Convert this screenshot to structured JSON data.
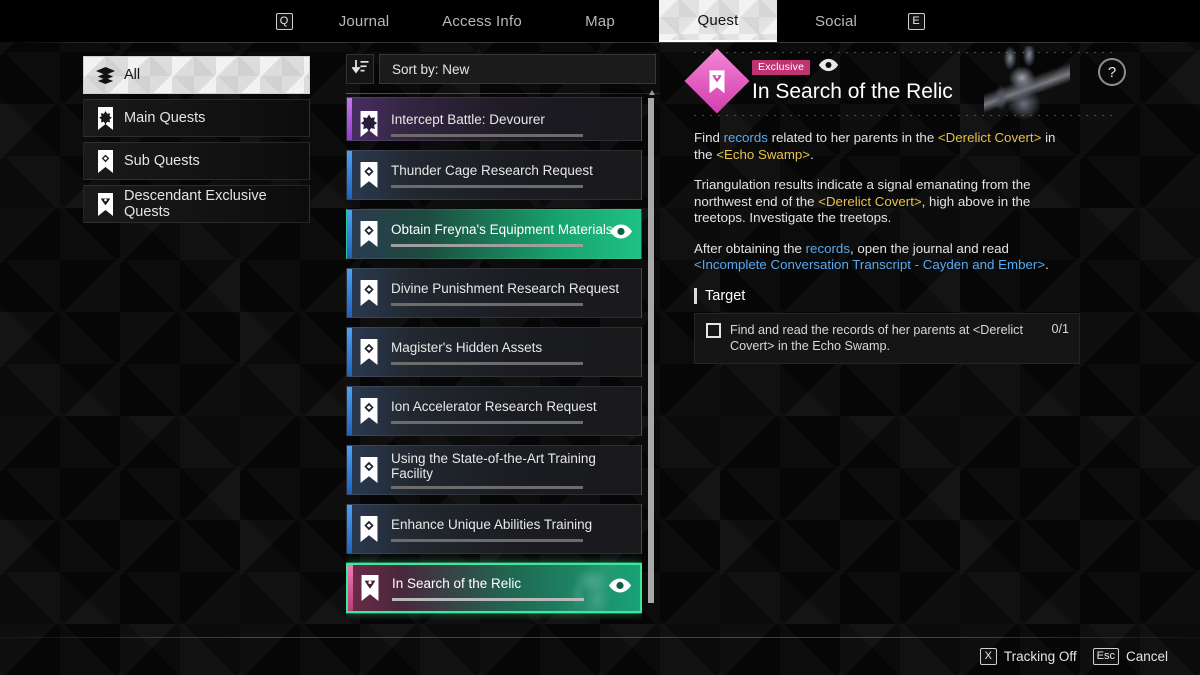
{
  "topbar": {
    "left_key": "Q",
    "right_key": "E",
    "tabs": [
      {
        "label": "Journal",
        "active": false
      },
      {
        "label": "Access Info",
        "active": false
      },
      {
        "label": "Map",
        "active": false
      },
      {
        "label": "Quest",
        "active": true
      },
      {
        "label": "Social",
        "active": false
      }
    ]
  },
  "sidebar": {
    "items": [
      {
        "label": "All",
        "icon": "layers-icon",
        "active": true
      },
      {
        "label": "Main Quests",
        "icon": "main-quest-bookmark-icon",
        "active": false
      },
      {
        "label": "Sub Quests",
        "icon": "sub-quest-bookmark-icon",
        "active": false
      },
      {
        "label": "Descendant Exclusive Quests",
        "icon": "exclusive-quest-bookmark-icon",
        "active": false
      }
    ]
  },
  "sort": {
    "icon": "sort-descending-icon",
    "label": "Sort by: New"
  },
  "quest_list": [
    {
      "title": "Intercept Battle: Devourer",
      "type": "main",
      "tracked": false,
      "selected": false,
      "partial": true
    },
    {
      "title": "Thunder Cage Research Request",
      "type": "sub",
      "tracked": false,
      "selected": false
    },
    {
      "title": "Obtain Freyna's Equipment Materials 1",
      "type": "sub",
      "tracked": true,
      "selected": false
    },
    {
      "title": "Divine Punishment Research Request",
      "type": "sub",
      "tracked": false,
      "selected": false
    },
    {
      "title": "Magister's Hidden Assets",
      "type": "sub",
      "tracked": false,
      "selected": false
    },
    {
      "title": "Ion Accelerator Research Request",
      "type": "sub",
      "tracked": false,
      "selected": false
    },
    {
      "title": "Using the State-of-the-Art Training Facility",
      "type": "sub",
      "tracked": false,
      "selected": false
    },
    {
      "title": "Enhance Unique Abilities Training",
      "type": "sub",
      "tracked": false,
      "selected": false
    },
    {
      "title": "In Search of the Relic",
      "type": "exclusive",
      "tracked": true,
      "selected": true
    }
  ],
  "detail": {
    "badge": "Exclusive",
    "tracked_icon": "eye-icon",
    "title": "In Search of the Relic",
    "help_label": "?",
    "paragraphs": [
      [
        {
          "t": "Find ",
          "s": "plain"
        },
        {
          "t": "records",
          "s": "blue"
        },
        {
          "t": " related to her parents in the ",
          "s": "plain"
        },
        {
          "t": "<Derelict Covert>",
          "s": "gold"
        },
        {
          "t": " in the ",
          "s": "plain"
        },
        {
          "t": "<Echo Swamp>",
          "s": "gold"
        },
        {
          "t": ".",
          "s": "plain"
        }
      ],
      [
        {
          "t": "Triangulation results indicate a signal emanating from the northwest end of the ",
          "s": "plain"
        },
        {
          "t": "<Derelict Covert>",
          "s": "gold"
        },
        {
          "t": ", high above in the treetops. Investigate the treetops.",
          "s": "plain"
        }
      ],
      [
        {
          "t": "After obtaining the ",
          "s": "plain"
        },
        {
          "t": "records",
          "s": "blue"
        },
        {
          "t": ", open the journal and read ",
          "s": "plain"
        },
        {
          "t": "<Incomplete Conversation Transcript - Cayden and Ember>",
          "s": "blue"
        },
        {
          "t": ".",
          "s": "plain"
        }
      ]
    ],
    "target_heading": "Target",
    "targets": [
      {
        "text": "Find and read the records of her parents at <Derelict Covert> in the Echo Swamp.",
        "count": "0/1",
        "checked": false
      }
    ]
  },
  "bottom_hints": [
    {
      "key": "X",
      "label": "Tracking Off"
    },
    {
      "key": "Esc",
      "label": "Cancel"
    }
  ],
  "colors": {
    "accent_green": "#3de89a",
    "accent_pink": "#e35fc0",
    "link_blue": "#5aa9ef",
    "link_gold": "#e7c24a",
    "badge_pink": "#c03370"
  }
}
